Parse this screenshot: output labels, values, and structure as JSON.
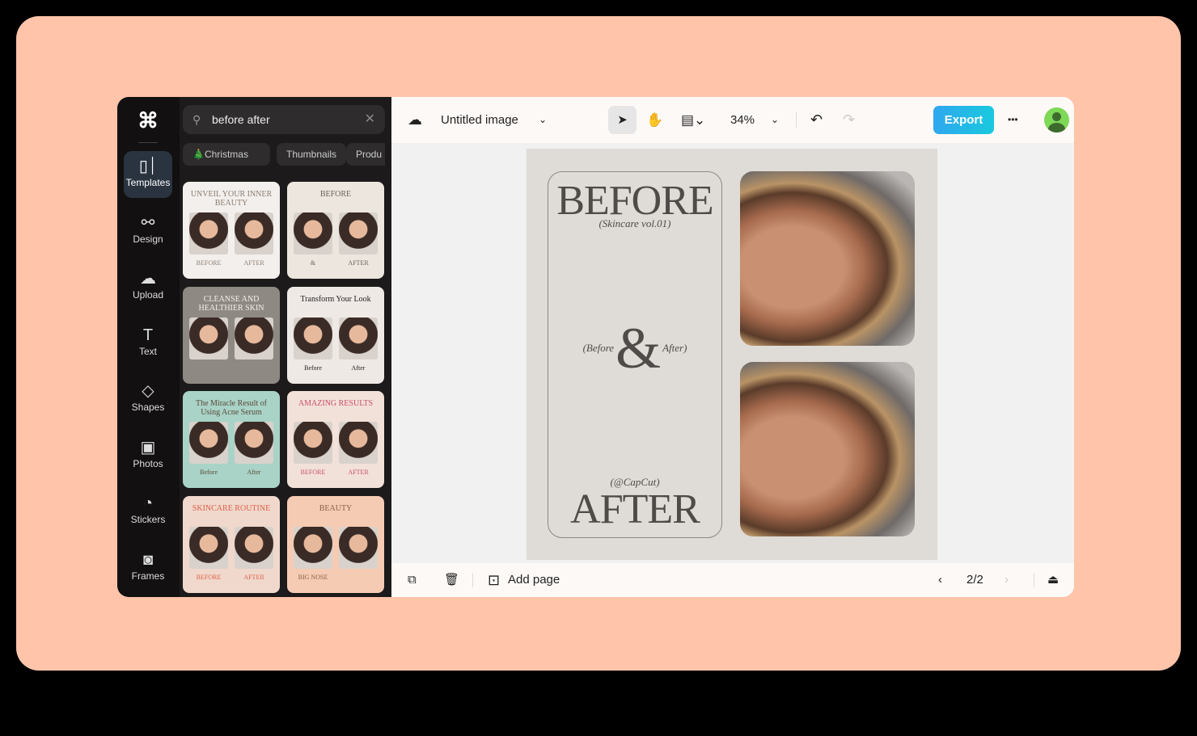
{
  "sidebar": {
    "items": [
      {
        "label": "Templates",
        "icon": "templates-icon",
        "glyph": "▯⏐"
      },
      {
        "label": "Design",
        "icon": "design-icon",
        "glyph": "⚯"
      },
      {
        "label": "Upload",
        "icon": "upload-cloud-icon",
        "glyph": "☁"
      },
      {
        "label": "Text",
        "icon": "text-icon",
        "glyph": "T"
      },
      {
        "label": "Shapes",
        "icon": "shapes-icon",
        "glyph": "◇"
      },
      {
        "label": "Photos",
        "icon": "photo-icon",
        "glyph": "▣"
      },
      {
        "label": "Stickers",
        "icon": "sticker-icon",
        "glyph": "◔"
      },
      {
        "label": "Frames",
        "icon": "frame-icon",
        "glyph": "◙"
      }
    ]
  },
  "panel": {
    "search_value": "before after",
    "chips": [
      "🎄Christmas",
      "Thumbnails",
      "Produ"
    ],
    "templates": [
      {
        "title": "UNVEIL YOUR INNER BEAUTY",
        "labels": [
          "BEFORE",
          "AFTER"
        ]
      },
      {
        "title": "BEFORE",
        "labels": [
          "&",
          "AFTER"
        ]
      },
      {
        "title": "CLEANSE AND HEALTHIER SKIN",
        "labels": []
      },
      {
        "title": "Transform Your Look",
        "labels": [
          "Before",
          "After"
        ]
      },
      {
        "title": "The Miracle Result of Using Acne Serum",
        "labels": [
          "Before",
          "After"
        ]
      },
      {
        "title": "AMAZING RESULTS",
        "labels": [
          "BEFORE",
          "AFTER"
        ]
      },
      {
        "title": "SKINCARE ROUTINE",
        "labels": [
          "BEFORE",
          "AFTER"
        ]
      },
      {
        "title": "BEAUTY",
        "labels": [
          "BIG NOSE"
        ]
      }
    ]
  },
  "topbar": {
    "title": "Untitled image",
    "zoom": "34%",
    "export_label": "Export",
    "more": "•••"
  },
  "canvas": {
    "before": "BEFORE",
    "subtitle": "(Skincare vol.01)",
    "before_small": "(Before",
    "amp": "&",
    "after_small": "After)",
    "handle": "(@CapCut)",
    "after": "AFTER"
  },
  "bottombar": {
    "add_page": "Add page",
    "page_indicator": "2/2"
  },
  "colors": {
    "accent": "#19c9de",
    "background": "#ffc4a9",
    "panel": "#1c1a1a"
  }
}
